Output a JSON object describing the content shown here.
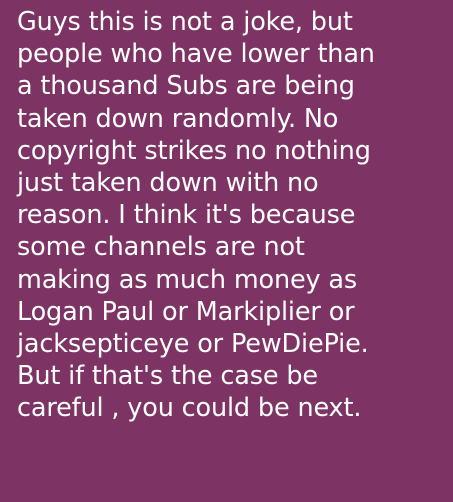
{
  "message": {
    "lines": [
      "Guys this is not a joke, but",
      "people who have lower than",
      "a thousand Subs are being",
      "taken down randomly. No",
      "copyright strikes no nothing",
      "just taken down with no",
      "reason. I think it's because",
      "some channels are not",
      "making as much money as",
      "Logan Paul or Markiplier or",
      "jacksepticeye or PewDiePie.",
      "But if that's the case be",
      "careful , you could be next."
    ]
  },
  "colors": {
    "bubble_background": "#7d3464",
    "text": "#ffffff"
  }
}
